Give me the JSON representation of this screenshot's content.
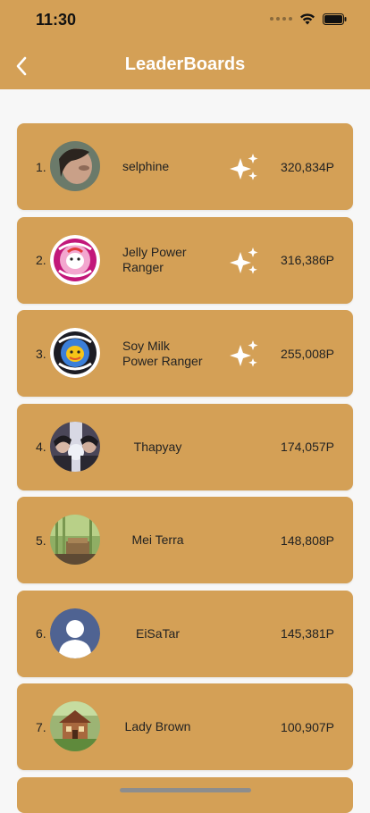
{
  "status_bar": {
    "time": "11:30"
  },
  "header": {
    "title": "LeaderBoards",
    "back_icon": "chevron-left-icon"
  },
  "colors": {
    "header": "#d4a056",
    "card": "#d4a056",
    "background": "#f7f7f7",
    "title": "#ffffff"
  },
  "leaderboard": [
    {
      "rank": "1.",
      "name_line1": "selphine",
      "name_line2": "",
      "points": "320,834P",
      "sparkle": true,
      "avatar": "photo-avatar"
    },
    {
      "rank": "2.",
      "name_line1": "Jelly Power",
      "name_line2": "Ranger",
      "points": "316,386P",
      "sparkle": true,
      "avatar": "power-rangers-pink-logo"
    },
    {
      "rank": "3.",
      "name_line1": "Soy Milk",
      "name_line2": "Power Ranger",
      "points": "255,008P",
      "sparkle": true,
      "avatar": "power-rangers-black-logo"
    },
    {
      "rank": "4.",
      "name_line1": "Thapyay",
      "name_line2": "",
      "points": "174,057P",
      "sparkle": false,
      "avatar": "photo-avatar"
    },
    {
      "rank": "5.",
      "name_line1": "Mei Terra",
      "name_line2": "",
      "points": "148,808P",
      "sparkle": false,
      "avatar": "photo-avatar"
    },
    {
      "rank": "6.",
      "name_line1": "EiSaTar",
      "name_line2": "",
      "points": "145,381P",
      "sparkle": false,
      "avatar": "default-person-avatar"
    },
    {
      "rank": "7.",
      "name_line1": "Lady Brown",
      "name_line2": "",
      "points": "100,907P",
      "sparkle": false,
      "avatar": "photo-avatar"
    }
  ]
}
